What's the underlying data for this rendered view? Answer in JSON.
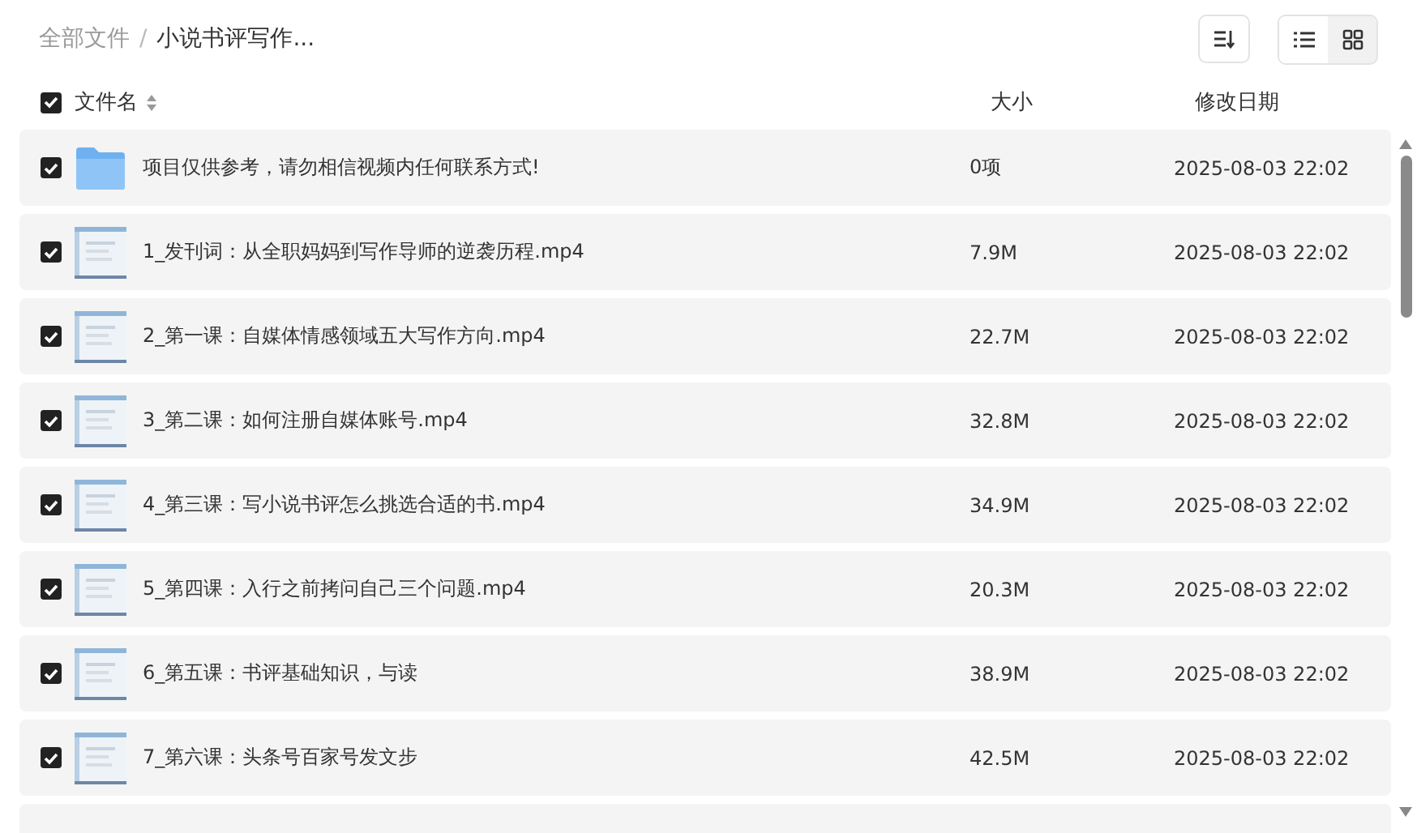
{
  "breadcrumb_separator": "/",
  "breadcrumb": [
    {
      "label": "全部文件",
      "current": false
    },
    {
      "label": "小说书评写作...",
      "current": true
    }
  ],
  "view_modes": [
    {
      "kind": "list",
      "selected": false
    },
    {
      "kind": "grid",
      "selected": true
    }
  ],
  "columns": {
    "select_all_checked": true,
    "name": "文件名",
    "size": "大小",
    "date": "修改日期"
  },
  "files": [
    {
      "kind": "folder",
      "checked": true,
      "name": "项目仅供参考，请勿相信视频内任何联系方式!",
      "size": "0项",
      "date": "2025-08-03 22:02"
    },
    {
      "kind": "video",
      "checked": true,
      "name": "1_发刊词：从全职妈妈到写作导师的逆袭历程.mp4",
      "size": "7.9M",
      "date": "2025-08-03 22:02"
    },
    {
      "kind": "video",
      "checked": true,
      "name": "2_第一课：自媒体情感领域五大写作方向.mp4",
      "size": "22.7M",
      "date": "2025-08-03 22:02"
    },
    {
      "kind": "video",
      "checked": true,
      "name": "3_第二课：如何注册自媒体账号.mp4",
      "size": "32.8M",
      "date": "2025-08-03 22:02"
    },
    {
      "kind": "video",
      "checked": true,
      "name": "4_第三课：写小说书评怎么挑选合适的书.mp4",
      "size": "34.9M",
      "date": "2025-08-03 22:02"
    },
    {
      "kind": "video",
      "checked": true,
      "name": "5_第四课：入行之前拷问自己三个问题.mp4",
      "size": "20.3M",
      "date": "2025-08-03 22:02"
    },
    {
      "kind": "video",
      "checked": true,
      "name": "6_第五课：书评基础知识，与读",
      "size": "38.9M",
      "date": "2025-08-03 22:02"
    },
    {
      "kind": "video",
      "checked": true,
      "name": "7_第六课：头条号百家号发文步",
      "size": "42.5M",
      "date": "2025-08-03 22:02"
    }
  ]
}
